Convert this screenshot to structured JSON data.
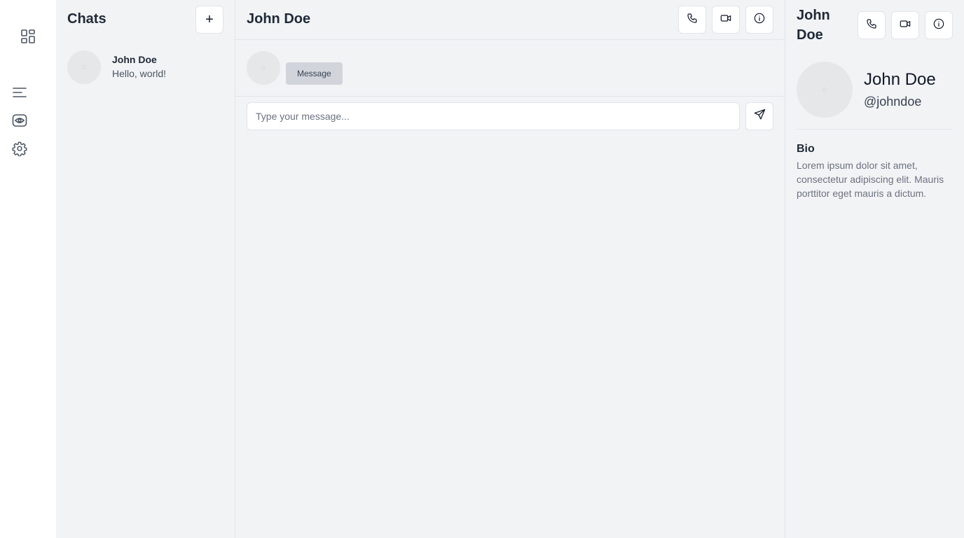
{
  "rail": {
    "icons": [
      "dashboard-icon",
      "menu-icon",
      "eye-icon",
      "gear-icon"
    ]
  },
  "chats": {
    "title": "Chats",
    "new_chat_label": "+",
    "items": [
      {
        "name": "John Doe",
        "preview": "Hello, world!"
      }
    ]
  },
  "conversation": {
    "title": "John Doe",
    "actions": [
      "phone-icon",
      "video-icon",
      "info-icon"
    ],
    "messages": [
      {
        "text": "Message"
      }
    ],
    "input_placeholder": "Type your message...",
    "input_value": ""
  },
  "profile": {
    "title": "John Doe",
    "actions": [
      "phone-icon",
      "video-icon",
      "info-icon"
    ],
    "name": "John Doe",
    "handle": "@johndoe",
    "bio_label": "Bio",
    "bio_text": "Lorem ipsum dolor sit amet, consectetur adipiscing elit. Mauris porttitor eget mauris a dictum."
  }
}
